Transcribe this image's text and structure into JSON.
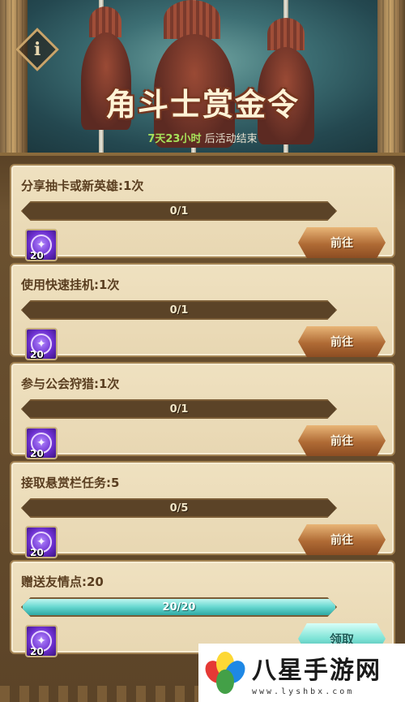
{
  "header": {
    "title": "角斗士赏金令",
    "countdown_value": "7天23小时",
    "countdown_suffix": "后活动结束",
    "info_label": "i"
  },
  "tasks": [
    {
      "title": "分享抽卡或新英雄:1次",
      "progress_text": "0/1",
      "progress": 0,
      "reward_count": "20",
      "button_label": "前往",
      "button_type": "go"
    },
    {
      "title": "使用快速挂机:1次",
      "progress_text": "0/1",
      "progress": 0,
      "reward_count": "20",
      "button_label": "前往",
      "button_type": "go"
    },
    {
      "title": "参与公会狩猎:1次",
      "progress_text": "0/1",
      "progress": 0,
      "reward_count": "20",
      "button_label": "前往",
      "button_type": "go"
    },
    {
      "title": "接取悬赏栏任务:5",
      "progress_text": "0/5",
      "progress": 0,
      "reward_count": "20",
      "button_label": "前往",
      "button_type": "go"
    },
    {
      "title": "赠送友情点:20",
      "progress_text": "20/20",
      "progress": 1,
      "reward_count": "20",
      "button_label": "领取",
      "button_type": "claim"
    }
  ],
  "watermark": {
    "name": "八星手游网",
    "url": "www.lyshbx.com"
  },
  "colors": {
    "go_button": "#b06b35",
    "claim_button": "#7ee3d6",
    "progress_fill": "#66d7cf",
    "card_bg": "#efe1c0"
  }
}
